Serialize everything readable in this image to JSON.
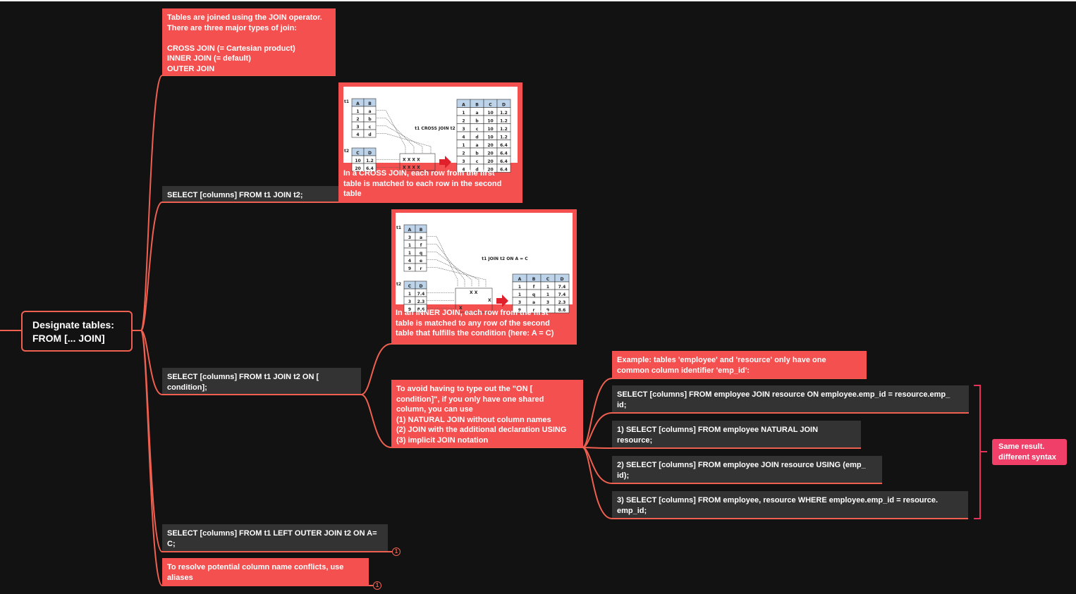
{
  "root": {
    "label": "Designate tables:\nFROM [... JOIN]"
  },
  "nodes": {
    "join_intro": "Tables are joined using the JOIN operator.\nThere are three major types of join:\n\nCROSS JOIN (= Cartesian product)\nINNER JOIN (= default)\nOUTER JOIN",
    "cross_join_sql": "SELECT [columns] FROM t1 JOIN t2;",
    "cross_join_caption": "In a CROSS JOIN, each row from the first\ntable is matched to each row in the second\ntable",
    "inner_join_sql": "SELECT [columns] FROM t1 JOIN t2 ON [\ncondition];",
    "inner_join_caption": "In an INNER JOIN, each row from the first\ntable is matched to any row of the second\ntable that fulfills the condition (here: A = C)",
    "avoid_on": "To avoid having to type out the \"ON [\ncondition]\", if you only have one shared\ncolumn, you can use\n(1) NATURAL JOIN without column names\n(2) JOIN with the additional declaration USING\n(3) implicit JOIN notation",
    "example": "Example: tables 'employee' and 'resource' only have one\ncommon column identifier 'emp_id':",
    "sql_on": "SELECT [columns] FROM employee JOIN resource ON employee.emp_id = resource.emp_\nid;",
    "sql_natural": "1) SELECT [columns] FROM employee NATURAL  JOIN\nresource;",
    "sql_using": "2) SELECT [columns] FROM employee JOIN resource USING (emp_\nid);",
    "sql_implicit": "3) SELECT [columns] FROM employee, resource WHERE employee.emp_id = resource.\nemp_id;",
    "same_result": "Same result.\ndifferent syntax",
    "outer_join_sql": "SELECT [columns] FROM t1 LEFT OUTER JOIN t2 ON A=\nC;",
    "aliases": "To resolve potential column name conflicts, use\naliases"
  },
  "badges": {
    "outer_join": "1",
    "aliases": "1"
  },
  "cross_image": {
    "t1_label": "t1",
    "t2_label": "t2",
    "t1_headers": [
      "A",
      "B"
    ],
    "t1_rows": [
      [
        "1",
        "a"
      ],
      [
        "2",
        "b"
      ],
      [
        "3",
        "c"
      ],
      [
        "4",
        "d"
      ]
    ],
    "t2_headers": [
      "C",
      "D"
    ],
    "t2_rows": [
      [
        "10",
        "1.2"
      ],
      [
        "20",
        "6.4"
      ]
    ],
    "op_label": "t1 CROSS JOIN t2",
    "marks_row": "X X X X",
    "result_headers": [
      "A",
      "B",
      "C",
      "D"
    ],
    "result_rows": [
      [
        "1",
        "a",
        "10",
        "1.2"
      ],
      [
        "2",
        "b",
        "10",
        "1.2"
      ],
      [
        "3",
        "c",
        "10",
        "1.2"
      ],
      [
        "4",
        "d",
        "10",
        "1.2"
      ],
      [
        "1",
        "a",
        "20",
        "6.4"
      ],
      [
        "2",
        "b",
        "20",
        "6.4"
      ],
      [
        "3",
        "c",
        "20",
        "6.4"
      ],
      [
        "4",
        "d",
        "20",
        "6.4"
      ]
    ]
  },
  "inner_image": {
    "t1_label": "t1",
    "t2_label": "t2",
    "t1_headers": [
      "A",
      "B"
    ],
    "t1_rows": [
      [
        "3",
        "a"
      ],
      [
        "1",
        "f"
      ],
      [
        "1",
        "q"
      ],
      [
        "4",
        "e"
      ],
      [
        "9",
        "r"
      ]
    ],
    "t2_headers": [
      "C",
      "D"
    ],
    "t2_rows": [
      [
        "1",
        "7.4"
      ],
      [
        "3",
        "2.3"
      ],
      [
        "9",
        "8.6"
      ]
    ],
    "op_label": "t1 JOIN t2 ON A = C",
    "marks": [
      "X  X",
      "X",
      "X"
    ],
    "result_headers": [
      "A",
      "B",
      "C",
      "D"
    ],
    "result_rows": [
      [
        "1",
        "f",
        "1",
        "7.4"
      ],
      [
        "1",
        "q",
        "1",
        "7.4"
      ],
      [
        "3",
        "a",
        "3",
        "2.3"
      ],
      [
        "9",
        "r",
        "9",
        "8.6"
      ]
    ]
  },
  "colors": {
    "background": "#121212",
    "node_red": "#f55050",
    "node_dark": "#333333",
    "edge": "#f06050",
    "badge_pink": "#f0406a"
  }
}
